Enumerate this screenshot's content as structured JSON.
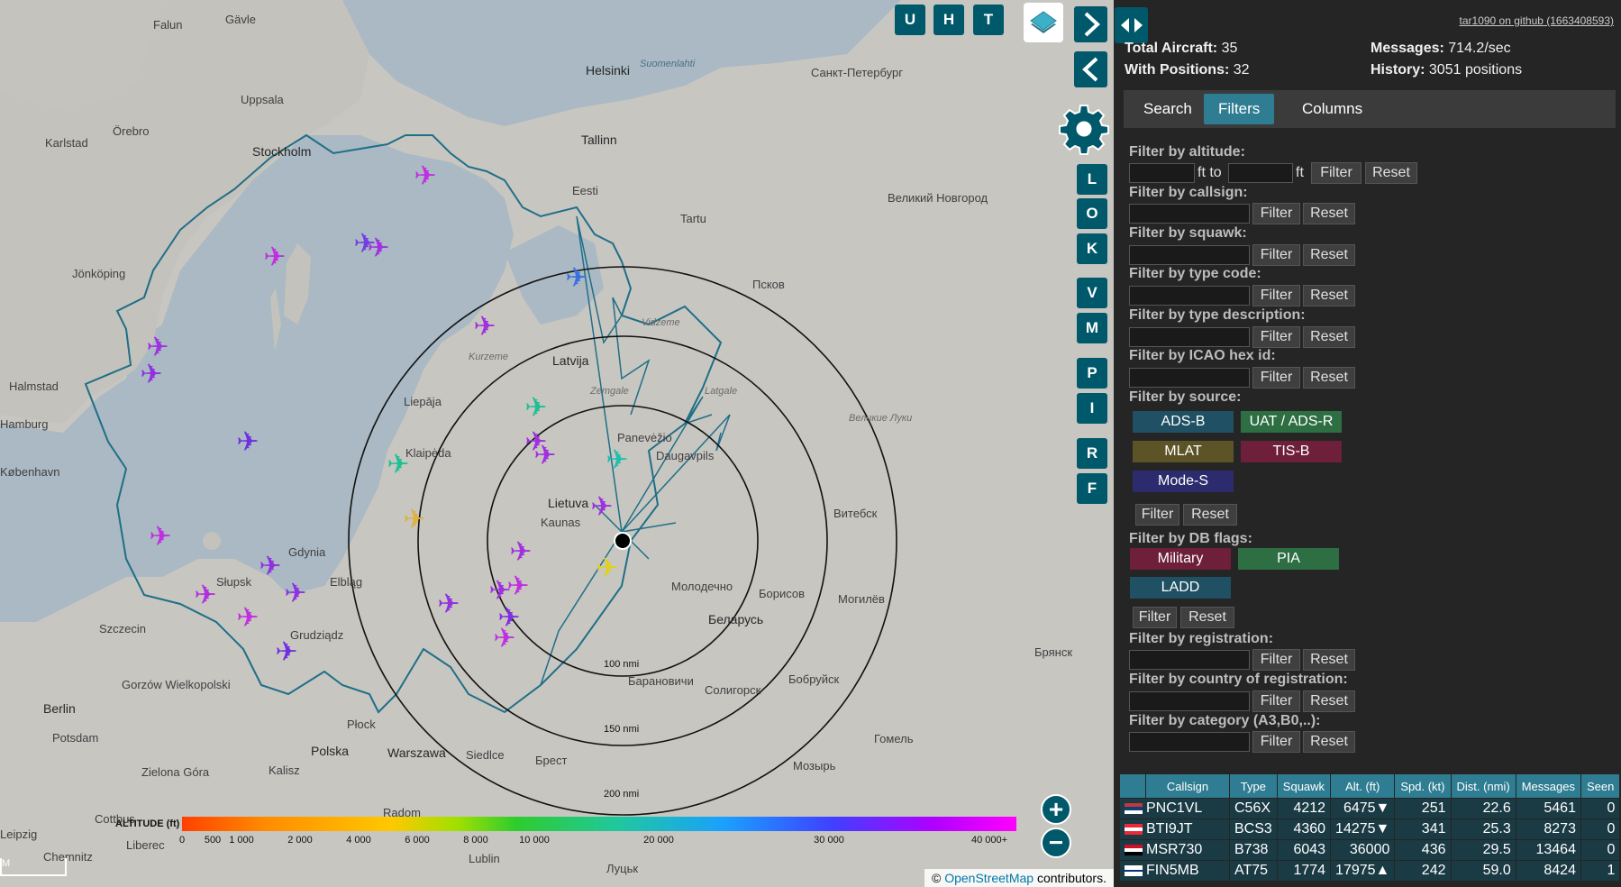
{
  "map": {
    "cities": [
      {
        "name": "Falun"
      },
      {
        "name": "Gävle"
      },
      {
        "name": "Uppsala"
      },
      {
        "name": "Stockholm"
      },
      {
        "name": "Karlstad"
      },
      {
        "name": "Örebro"
      },
      {
        "name": "Jönköping"
      },
      {
        "name": "Halmstad"
      },
      {
        "name": "Helsinki"
      },
      {
        "name": "Tallinn"
      },
      {
        "name": "Eesti"
      },
      {
        "name": "Tartu"
      },
      {
        "name": "Санкт-Петербург"
      },
      {
        "name": "Псков"
      },
      {
        "name": "Великий Новгород"
      },
      {
        "name": "Latvija"
      },
      {
        "name": "Liepāja"
      },
      {
        "name": "Klaipėda"
      },
      {
        "name": "Lietuva"
      },
      {
        "name": "Kaunas"
      },
      {
        "name": "Daugavpils"
      },
      {
        "name": "Panevėžio"
      },
      {
        "name": "Витебск"
      },
      {
        "name": "Могилёв"
      },
      {
        "name": "Молодечно"
      },
      {
        "name": "Борисов"
      },
      {
        "name": "Беларусь"
      },
      {
        "name": "Gdynia"
      },
      {
        "name": "Słupsk"
      },
      {
        "name": "Elbląg"
      },
      {
        "name": "Grudziądz"
      },
      {
        "name": "Polska"
      },
      {
        "name": "Warszawa"
      },
      {
        "name": "Płock"
      },
      {
        "name": "Berlin"
      },
      {
        "name": "Potsdam"
      },
      {
        "name": "Szczecin"
      },
      {
        "name": "Gorzów Wielkopolski"
      },
      {
        "name": "Zielona Góra"
      },
      {
        "name": "Kalisz"
      },
      {
        "name": "Radom"
      },
      {
        "name": "Liberec"
      },
      {
        "name": "Chemnitz"
      },
      {
        "name": "Брест"
      },
      {
        "name": "Барановичи"
      },
      {
        "name": "Солигорск"
      },
      {
        "name": "Бобруйск"
      },
      {
        "name": "Гомель"
      },
      {
        "name": "Мозырь"
      },
      {
        "name": "Брянск"
      },
      {
        "name": "Луцьк"
      },
      {
        "name": "Siedlce"
      },
      {
        "name": "Lublin"
      },
      {
        "name": "Zemgale"
      },
      {
        "name": "Latgale"
      },
      {
        "name": "Vidzeme"
      },
      {
        "name": "Kurzeme"
      },
      {
        "name": "Suomenlahti"
      },
      {
        "name": "Великие Луки"
      },
      {
        "name": "Cottbus"
      },
      {
        "name": "Leipzig"
      },
      {
        "name": "Hamburg"
      },
      {
        "name": "København"
      }
    ],
    "ring_labels": [
      "100 nmi",
      "150 nmi",
      "200 nmi"
    ],
    "altitude": {
      "label": "ALTITUDE (ft)",
      "ticks": [
        "0",
        "500",
        "1 000",
        "2 000",
        "4 000",
        "6 000",
        "8 000",
        "10 000",
        "20 000",
        "30 000",
        "40 000+"
      ]
    },
    "buttons": {
      "u": "U",
      "h": "H",
      "t": "T",
      "l": "L",
      "o": "O",
      "k": "K",
      "v": "V",
      "m": "M",
      "p": "P",
      "i": "I",
      "r": "R",
      "f": "F",
      "zoom_in": "+",
      "zoom_out": "−"
    },
    "attribution": {
      "prefix": "©",
      "link": "OpenStreetMap",
      "suffix": "contributors."
    },
    "scale_text": "M"
  },
  "sidebar": {
    "github_link": "tar1090 on github (1663408593)",
    "stats": {
      "total_label": "Total Aircraft:",
      "total_value": "35",
      "positions_label": "With Positions:",
      "positions_value": "32",
      "messages_label": "Messages:",
      "messages_value": "714.2/sec",
      "history_label": "History:",
      "history_value": "3051 positions"
    },
    "tabs": [
      "Search",
      "Filters",
      "Columns"
    ],
    "filters": {
      "altitude": "Filter by altitude:",
      "ft_to": "ft to",
      "ft": "ft",
      "callsign": "Filter by callsign:",
      "squawk": "Filter by squawk:",
      "type_code": "Filter by type code:",
      "type_desc": "Filter by type description:",
      "icao": "Filter by ICAO hex id:",
      "source": "Filter by source:",
      "dbflags": "Filter by DB flags:",
      "registration": "Filter by registration:",
      "country": "Filter by country of registration:",
      "category": "Filter by category (A3,B0,..):",
      "filter_btn": "Filter",
      "reset_btn": "Reset"
    },
    "sources": [
      {
        "label": "ADS-B",
        "color": "#1f5063"
      },
      {
        "label": "UAT / ADS-R",
        "color": "#2e6e43"
      },
      {
        "label": "MLAT",
        "color": "#5c5426"
      },
      {
        "label": "TIS-B",
        "color": "#6e1f3a"
      },
      {
        "label": "Mode-S",
        "color": "#2b2b6e"
      }
    ],
    "db_flags": [
      {
        "label": "Military",
        "color": "#6e1f3a"
      },
      {
        "label": "PIA",
        "color": "#2e6e43"
      },
      {
        "label": "LADD",
        "color": "#1f5063"
      }
    ],
    "table": {
      "headers": [
        "",
        "Callsign",
        "Type",
        "Squawk",
        "Alt. (ft)",
        "Spd. (kt)",
        "Dist. (nmi)",
        "Messages",
        "Seen"
      ],
      "rows": [
        {
          "flag": "rs",
          "callsign": "PNC1VL",
          "type": "C56X",
          "squawk": "4212",
          "alt": "6475▼",
          "spd": "251",
          "dist": "22.6",
          "msgs": "5461",
          "seen": "0"
        },
        {
          "flag": "at",
          "callsign": "BTI9JT",
          "type": "BCS3",
          "squawk": "4360",
          "alt": "14275▼",
          "spd": "341",
          "dist": "25.3",
          "msgs": "8273",
          "seen": "0"
        },
        {
          "flag": "eg",
          "callsign": "MSR730",
          "type": "B738",
          "squawk": "6043",
          "alt": "36000",
          "spd": "436",
          "dist": "29.5",
          "msgs": "13464",
          "seen": "0"
        },
        {
          "flag": "fi",
          "callsign": "FIN5MB",
          "type": "AT75",
          "squawk": "1774",
          "alt": "17975▲",
          "spd": "242",
          "dist": "59.0",
          "msgs": "8424",
          "seen": "1"
        }
      ]
    }
  }
}
